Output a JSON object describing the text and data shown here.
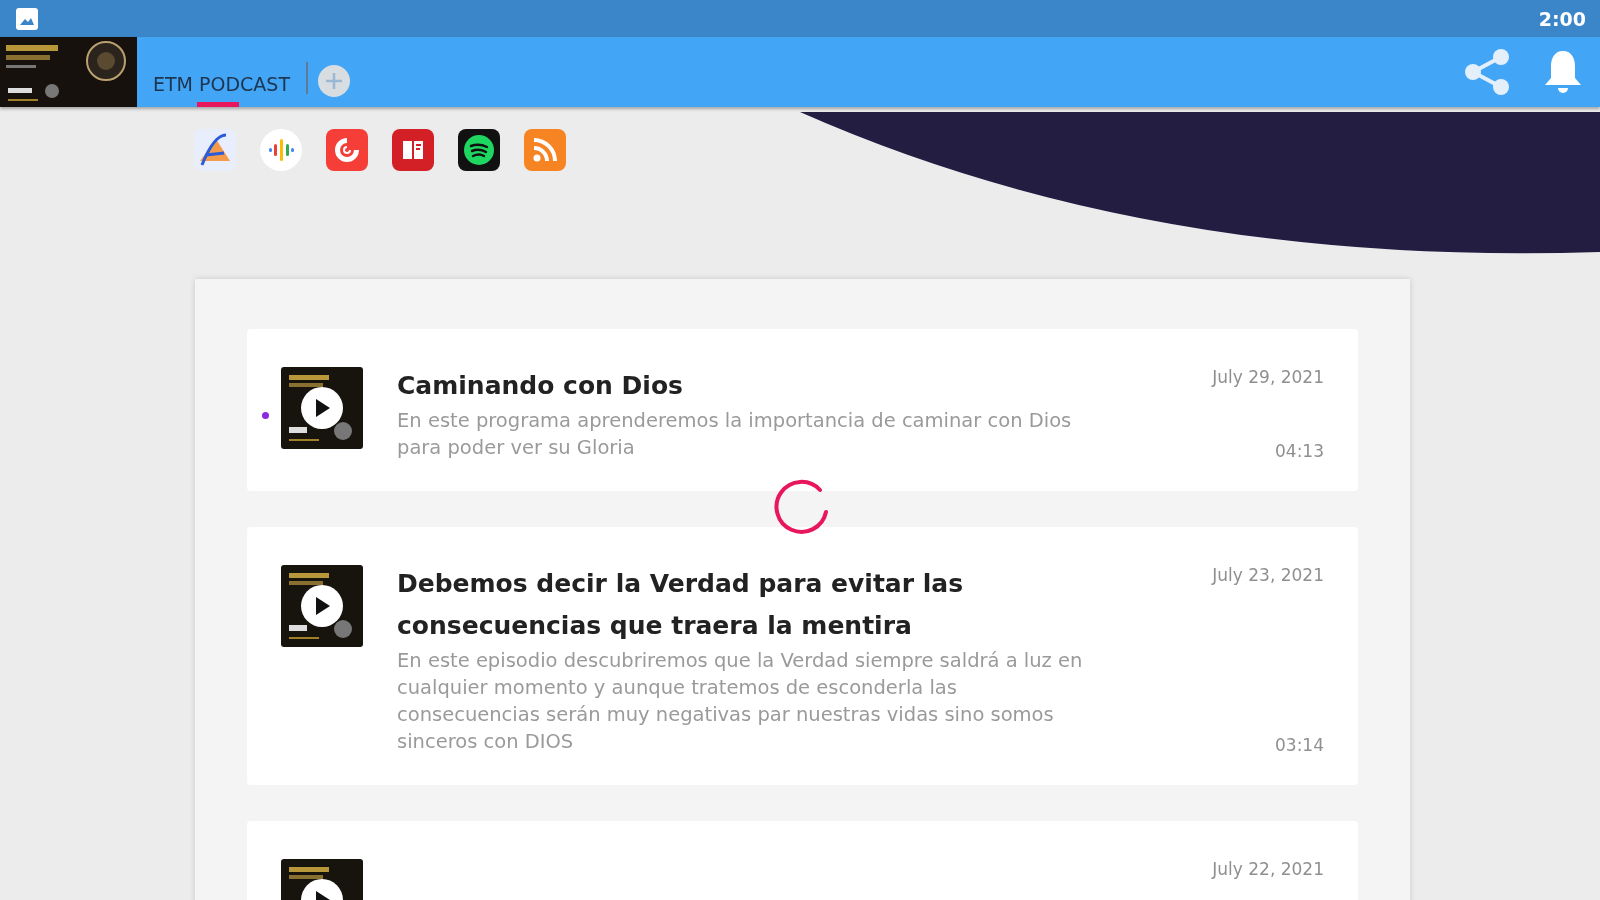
{
  "status_bar": {
    "time": "2:00"
  },
  "app_bar": {
    "tabs": [
      {
        "label": "ETM PODCAST",
        "selected": true
      }
    ]
  },
  "platforms": [
    {
      "kind": "apple"
    },
    {
      "kind": "google"
    },
    {
      "kind": "pocketcasts"
    },
    {
      "kind": "castbox"
    },
    {
      "kind": "spotify"
    },
    {
      "kind": "rss"
    }
  ],
  "loading": true,
  "episodes": [
    {
      "title": "Caminando con Dios",
      "description": "En este programa aprenderemos la importancia de caminar con Dios para poder ver su Gloria",
      "date": "July 29, 2021",
      "duration": "04:13",
      "unread": true
    },
    {
      "title": "Debemos decir la Verdad para evitar las consecuencias que traera la mentira",
      "description": "En este episodio descubriremos que la Verdad siempre saldrá a luz en cualquier momento y aunque tratemos de esconderla las consecuencias serán muy negativas par nuestras vidas sino somos sinceros con DIOS",
      "date": "July 23, 2021",
      "duration": "03:14",
      "unread": false
    },
    {
      "date": "July 22, 2021",
      "unread": false
    }
  ]
}
